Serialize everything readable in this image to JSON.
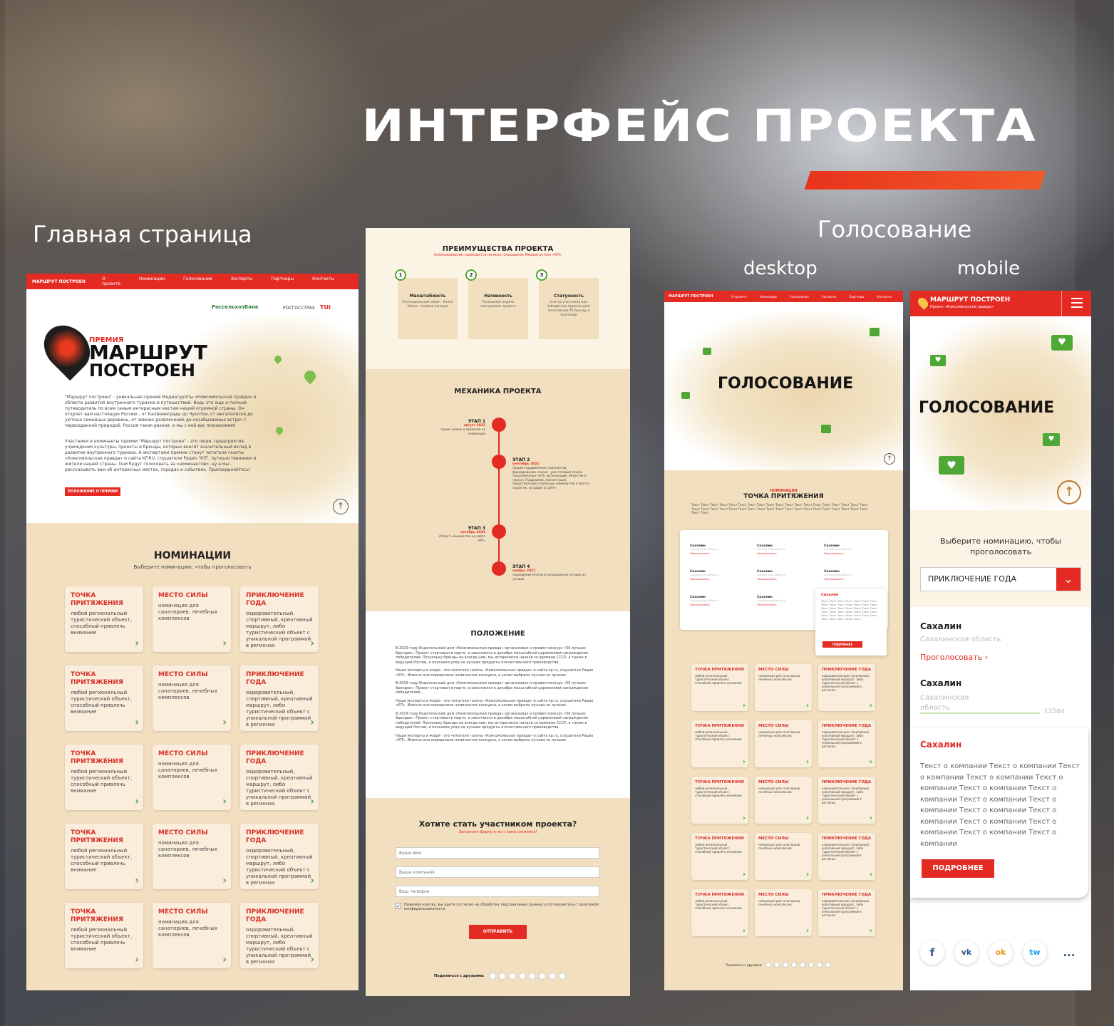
{
  "page": {
    "heading": "ИНТЕРФЕЙС ПРОЕКТА",
    "captions": {
      "home": "Главная страница",
      "voting": "Голосование",
      "desktop": "desktop",
      "mobile": "mobile"
    }
  },
  "home": {
    "logo": "МАРШРУТ ПОСТРОЕН",
    "nav": [
      "О проекте",
      "Номинации",
      "Голосование",
      "Эксперты",
      "Партнеры",
      "Контакты"
    ],
    "partners": [
      "РоссельхозБанк",
      "РОСГОССТРАХ",
      "TUI"
    ],
    "hero_pre": "ПРЕМИЯ",
    "hero_title_1": "МАРШРУТ",
    "hero_title_2": "ПОСТРОЕН",
    "hero_text_1": "\"Маршрут построен\" - уникальная премия Медиагруппы «Комсомольская правда» в области развития внутреннего туризма и путешествий. Ведь это еще и полный путеводитель по всем самым интересным местам нашей огромной страны. Он откроет вам настоящую Россию - от Калининграда до Чукотки, от мегаполисов до уютных семейных деревень, от зимних развлечений до незабываемых встреч с первозданной природой. Россия такая разная, и мы с ней вас познакомим!",
    "hero_text_2": "Участники и номинанты премии \"Маршрут построен\" - это люди, предприятия, учреждения культуры, проекты и бренды, которые вносят значительный вклад в развитие внутреннего туризма. А экспертами премии станут читатели газеты «Комсомольская правда» и сайта KP.RU, слушатели Радио \"КП\", путешественники и жители нашей страны. Они будут голосовать за «номинантов», ну а мы - рассказывать вам об интересных местах, городах и событиях. Присоединяйтесь!",
    "hero_button": "ПОЛОЖЕНИЕ О ПРЕМИИ",
    "nominations_title": "НОМИНАЦИИ",
    "nominations_sub": "Выберите номинацию, чтобы проголосовать",
    "cards": [
      {
        "title": "ТОЧКА ПРИТЯЖЕНИЯ",
        "desc": "любой региональный туристический объект, способный привлечь внимание"
      },
      {
        "title": "МЕСТО СИЛЫ",
        "desc": "номинация для санаториев, лечебных комплексов"
      },
      {
        "title": "ПРИКЛЮЧЕНИЕ ГОДА",
        "desc": "оздоровительный, спортивный, креативный маршрут, либо туристический объект с уникальной программой в регионах"
      }
    ]
  },
  "about": {
    "adv_title": "ПРЕИМУЩЕСТВА ПРОЕКТА",
    "adv_sub": "Анонсирование проводится на всех площадках Медиагруппы «КП»",
    "adv": [
      {
        "num": "1",
        "title": "Масштабность",
        "desc": "Потенциальный охват - более 10млн. человек вживую"
      },
      {
        "num": "2",
        "title": "Нативность",
        "desc": "Роскошная подача материалов проекта"
      },
      {
        "num": "3",
        "title": "Статусность",
        "desc": "Статус участника или победителя проекта дает позитивный PR бренду и компании"
      }
    ],
    "mech_title": "МЕХАНИКА ПРОЕКТА",
    "stages": [
      {
        "label": "ЭТАП 1",
        "date": "август 2021",
        "desc": "прием заявок и проектов на номинации"
      },
      {
        "label": "ЭТАП 2",
        "date": "сентябрь 2021",
        "desc": "процесс выдвижения номинантов: формирование списка - уже готовый список предложенных «КП» организаций, объектов и персон. Поддержка, презентация, представление отдельных номинантов в прессе, соцсетях, на радио и сайте"
      },
      {
        "label": "ЭТАП 3",
        "date": "октябрь 2021",
        "desc": "отбор 5 номинантов на сайте «КП»"
      },
      {
        "label": "ЭТАП 4",
        "date": "ноябрь 2021",
        "desc": "подведение итогов и награждение лучших из лучших"
      }
    ],
    "reg_title": "ПОЛОЖЕНИЕ",
    "reg_paragraphs": [
      "В 2019 году Издательский дом «Комсомольская правда» организовал и провел конкурс «50 лучших брендов». Проект стартовал в марте, а закончился в декабре масштабной церемонией награждения победителей. Поскольку бренды не всегда нам, мы исторически начали со времени СССР, а также в ведущей России, и показали упор на лучшие продукты отечественного производства.",
      "Наши эксперты и жюри - это читатели газеты «Комсомольская правда» и сайта kp.ru, слушатели Радио «КП». Именно они определили номинантов конкурса, а затем выбрали лучших из лучших.",
      "В 2019 году Издательский дом «Комсомольская правда» организовал и провел конкурс «50 лучших брендов». Проект стартовал в марте, а закончился в декабре масштабной церемонией награждения победителей.",
      "Наши эксперты и жюри - это читатели газеты «Комсомольская правда» и сайта kp.ru, слушатели Радио «КП». Именно они определили номинантов конкурса, а затем выбрали лучших из лучших."
    ],
    "form_title": "Хотите стать участником проекта?",
    "form_sub": "Заполните форму и мы с вами свяжемся!",
    "form_fields": [
      "Ваше имя",
      "Ваша компания",
      "Ваш телефон"
    ],
    "consent": "Нажимая кнопку, вы даете согласие на обработку персональных данных и соглашаетесь с политикой конфиденциальности",
    "submit": "ОТПРАВИТЬ",
    "share": "Поделиться с друзьями:"
  },
  "vote_desktop": {
    "logo": "МАРШРУТ ПОСТРОЕН",
    "nav": [
      "О проекте",
      "Номинации",
      "Голосование",
      "Эксперты",
      "Партнеры",
      "Контакты"
    ],
    "hero": "ГОЛОСОВАНИЕ",
    "nom_pre": "НОМИНАЦИЯ",
    "nom_title": "ТОЧКА ПРИТЯЖЕНИЯ",
    "nom_text": "Текст Текст Текст Текст Текст Текст Текст Текст Текст Текст Текст Текст Текст Текст Текст Текст Текст Текст Текст Текст Текст Текст Текст Текст Текст Текст Текст Текст Текст Текст Текст Текст Текст Текст Текст Текст Текст Текст Текст Текст",
    "entry_name": "Сахалин",
    "entry_region": "Сахалинская область",
    "entry_vote": "Проголосовать",
    "popup_button": "ПОДРОБНЕЕ",
    "share": "Поделиться с друзьями:"
  },
  "vote_mobile": {
    "logo": "МАРШРУТ ПОСТРОЕН",
    "logo_sub": "Проект «Комсомольской правды»",
    "hero": "ГОЛОСОВАНИЕ",
    "select_prompt": "Выберите номинацию, чтобы проголосовать",
    "select_value": "ПРИКЛЮЧЕНИЕ ГОДА",
    "entry1_name": "Сахалин",
    "entry1_region": "Сахалинская область",
    "entry1_vote": "Проголосовать",
    "entry2_name": "Сахалин",
    "entry2_region_1": "Сахалинская",
    "entry2_region_2": "область",
    "entry2_count": "12564",
    "popup_name": "Сахалин",
    "popup_text": "Текст о компании Текст о компании Текст о компании Текст о компании Текст о компании Текст о компании Текст о компании Текст о компании Текст о компании Текст о компании Текст о компании Текст о компании Текст о компании Текст о компании Текст о компании",
    "popup_button": "ПОДРОБНЕЕ",
    "socials": [
      "f",
      "vk",
      "ok",
      "tw",
      "..."
    ]
  },
  "colors": {
    "accent": "#e32b24",
    "beige": "#f2dfbf",
    "green": "#4fa735"
  }
}
